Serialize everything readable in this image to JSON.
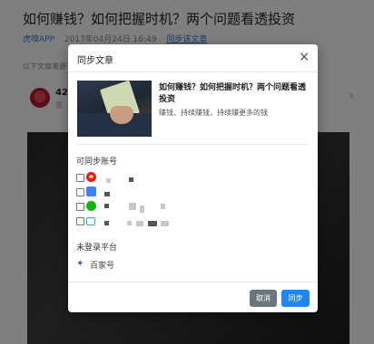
{
  "article": {
    "title": "如何赚钱？如何把握时机？两个问题看透投资",
    "source": "虎嗅APP",
    "date": "2017年04月24日 16:49",
    "sync_link": "同步该文章",
    "intro": "以下文章来源",
    "author_number": "42",
    "author_sub": "思"
  },
  "modal": {
    "title": "同步文章",
    "close_label": "×",
    "preview": {
      "title": "如何赚钱？如何把握时机？两个问题看透投资",
      "description": "赚钱、持续赚钱，持续赚更多的钱"
    },
    "sync_accounts_label": "可同步账号",
    "accounts": [
      {
        "platform_icon": "weibo-icon",
        "checked": false
      },
      {
        "platform_icon": "toutiao-icon",
        "checked": false
      },
      {
        "platform_icon": "wechat-icon",
        "checked": false
      },
      {
        "platform_icon": "bilibili-icon",
        "checked": false
      }
    ],
    "unlogged_label": "未登录平台",
    "unlogged_platform": {
      "icon": "baidu-paw-icon",
      "label": "百家号"
    },
    "cancel_label": "取消",
    "sync_label": "同步"
  },
  "colors": {
    "accent": "#1e87f0",
    "cancel": "#6c757d",
    "link": "#3a7bd5",
    "overlay": "rgba(0,0,0,0.5)"
  }
}
